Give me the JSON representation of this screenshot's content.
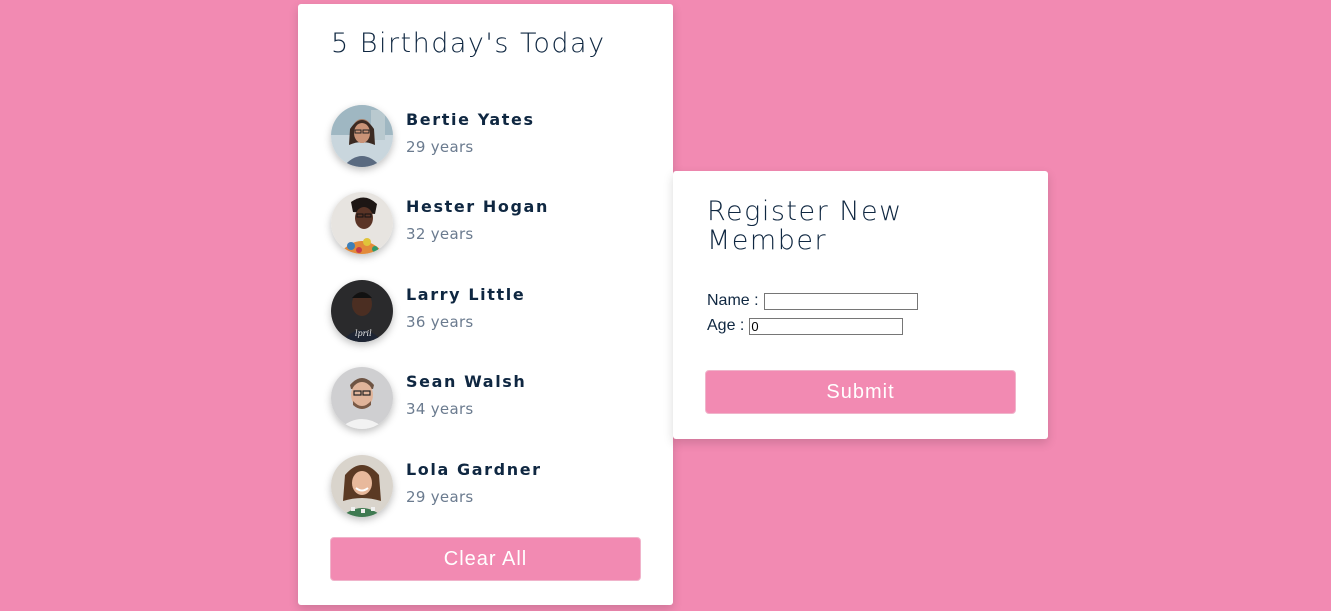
{
  "birthdays": {
    "title": "5 Birthday's Today",
    "people": [
      {
        "name": "Bertie Yates",
        "age": "29 years",
        "avatar": "photo-woman-glasses"
      },
      {
        "name": "Hester Hogan",
        "age": "32 years",
        "avatar": "photo-woman-floral"
      },
      {
        "name": "Larry Little",
        "age": "36 years",
        "avatar": "photo-man-dark"
      },
      {
        "name": "Sean Walsh",
        "age": "34 years",
        "avatar": "photo-man-glasses"
      },
      {
        "name": "Lola Gardner",
        "age": "29 years",
        "avatar": "photo-woman-curly"
      }
    ],
    "clear_label": "Clear All"
  },
  "register": {
    "title": "Register New Member",
    "name_label": "Name :",
    "name_value": "",
    "age_label": "Age :",
    "age_value": "0",
    "submit_label": "Submit"
  },
  "colors": {
    "background": "#f28ab2",
    "accent": "#f28ab2",
    "text_dark": "#0f2741",
    "text_muted": "#6b7b8f"
  }
}
